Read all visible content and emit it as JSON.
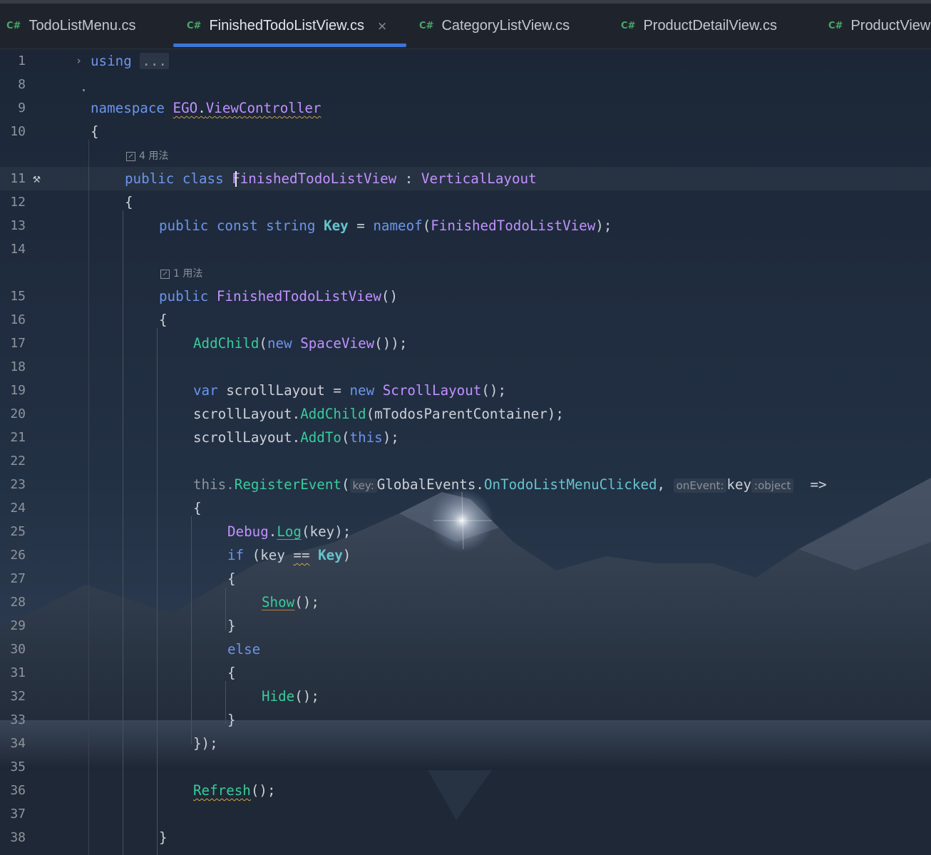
{
  "tabs": [
    {
      "lang": "C#",
      "label": "TodoListMenu.cs"
    },
    {
      "lang": "C#",
      "label": "FinishedTodoListView.cs",
      "close": "×"
    },
    {
      "lang": "C#",
      "label": "CategoryListView.cs"
    },
    {
      "lang": "C#",
      "label": "ProductDetailView.cs"
    },
    {
      "lang": "C#",
      "label": "ProductView"
    }
  ],
  "active_tab": 1,
  "line_numbers": [
    "1",
    "8",
    "9",
    "10",
    "11",
    "12",
    "13",
    "14",
    "15",
    "16",
    "17",
    "18",
    "19",
    "20",
    "21",
    "22",
    "23",
    "24",
    "25",
    "26",
    "27",
    "28",
    "29",
    "30",
    "31",
    "32",
    "33",
    "34",
    "35",
    "36",
    "37",
    "38"
  ],
  "usage_hints": [
    "4 用法",
    "1 用法"
  ],
  "code": {
    "l1_kw": "using",
    "l1_collapsed": "...",
    "l9_kw": "namespace",
    "l9_ns1": "EGO",
    "l9_dot": ".",
    "l9_ns2": "ViewController",
    "l10": "{",
    "l11_kw": "public class",
    "l11_name": "FinishedTodoListView",
    "l11_colon": " : ",
    "l11_base": "VerticalLayout",
    "l12": "{",
    "l13_kw": "public const string",
    "l13_const": "Key",
    "l13_eq": " = ",
    "l13_fn": "nameof",
    "l13_p1": "(",
    "l13_arg": "FinishedTodoListView",
    "l13_p2": ");",
    "l15_kw": "public",
    "l15_name": "FinishedTodoListView",
    "l15_p": "()",
    "l16": "{",
    "l17_fn": "AddChild",
    "l17_p1": "(",
    "l17_new": "new",
    "l17_ty": "SpaceView",
    "l17_p2": "());",
    "l19_var": "var",
    "l19_id": " scrollLayout = ",
    "l19_new": "new",
    "l19_ty": "ScrollLayout",
    "l19_p": "();",
    "l20_id": "scrollLayout",
    "l20_dot": ".",
    "l20_fn": "AddChild",
    "l20_p1": "(",
    "l20_arg": "mTodosParentContainer",
    "l20_p2": ");",
    "l21_id": "scrollLayout",
    "l21_dot": ".",
    "l21_fn": "AddTo",
    "l21_p1": "(",
    "l21_this": "this",
    "l21_p2": ");",
    "l23_this": "this",
    "l23_dot": ".",
    "l23_fn": "RegisterEvent",
    "l23_p1": "(",
    "l23_hint1": "key:",
    "l23_cls": "GlobalEvents",
    "l23_dot2": ".",
    "l23_fld": "OnTodoListMenuClicked",
    "l23_comma": ",",
    "l23_hint2": "onEvent:",
    "l23_param": "key",
    "l23_hint3": ":object",
    "l23_arrow": "=>",
    "l24": "{",
    "l25_cls": "Debug",
    "l25_dot": ".",
    "l25_fn": "Log",
    "l25_p": "(key);",
    "l26_kw": "if",
    "l26_a": " (key ",
    "l26_op": "==",
    "l26_sp": " ",
    "l26_key": "Key",
    "l26_p": ")",
    "l27": "{",
    "l28_fn": "Show",
    "l28_p": "();",
    "l29": "}",
    "l30_kw": "else",
    "l31": "{",
    "l32_fn": "Hide",
    "l32_p": "();",
    "l33": "}",
    "l34": "});",
    "l36_fn": "Refresh",
    "l36_p": "();",
    "l38": "}"
  },
  "colors": {
    "keyword": "#6c95eb",
    "type": "#c191ff",
    "method": "#39cc9b",
    "field": "#66c3cc",
    "accent_tab": "#3d74d6",
    "csharp_badge": "#4aa86a"
  },
  "icons": [
    "fold-arrow-icon",
    "hammer-icon",
    "usage-link-icon",
    "close-icon"
  ]
}
